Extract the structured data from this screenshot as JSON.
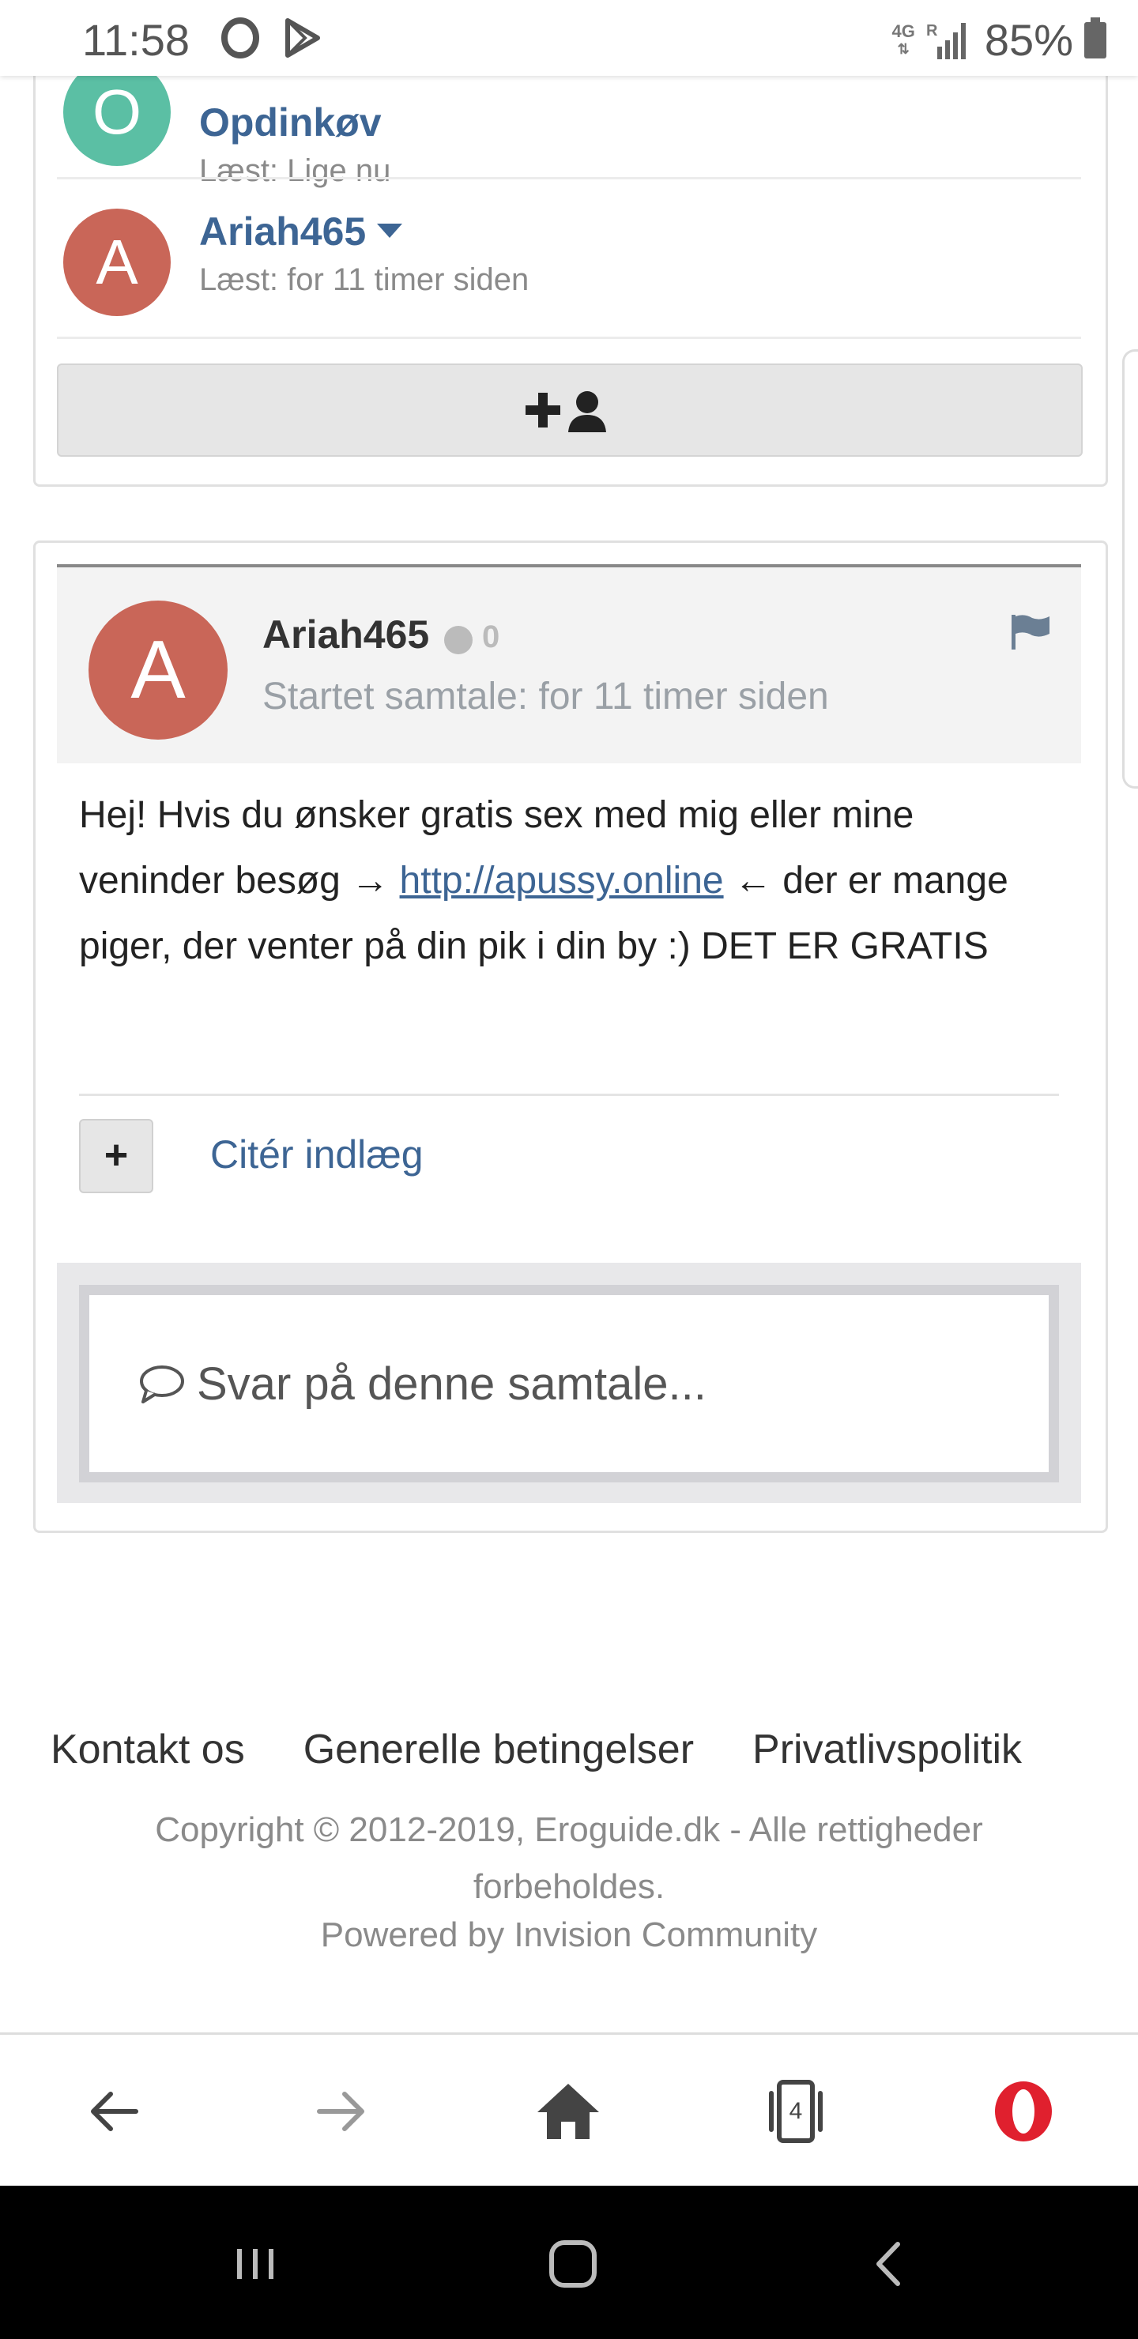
{
  "status_bar": {
    "time": "11:58",
    "network": "4G",
    "roaming": "R",
    "battery": "85%"
  },
  "viewers": [
    {
      "initial": "O",
      "name": "Opdinkøv",
      "last_read": "Læst: Lige nu",
      "avatar_color": "#5bbfa4"
    },
    {
      "initial": "A",
      "name": "Ariah465",
      "last_read": "Læst: for 11 timer siden",
      "avatar_color": "#c96658"
    }
  ],
  "post": {
    "avatar_initial": "A",
    "author": "Ariah465",
    "reputation": "0",
    "started": "Startet samtale: for 11 timer siden",
    "body_before_link": "Hej! Hvis du ønsker gratis sex med mig eller mine veninder besøg → ",
    "link_text": "http://apussy.online",
    "body_after_link": " ← der er mange piger, der venter på din pik i din by :) DET ER GRATIS",
    "multiquote_label": "+",
    "quote_label": "Citér indlæg"
  },
  "reply": {
    "placeholder": "Svar på denne samtale..."
  },
  "footer": {
    "links": [
      "Kontakt os",
      "Generelle betingelser",
      "Privatlivspolitik"
    ],
    "copyright": "Copyright © 2012-2019, Eroguide.dk - Alle rettigheder forbeholdes.",
    "powered": "Powered by Invision Community"
  },
  "browser": {
    "tab_count": "4"
  },
  "colors": {
    "link": "#3d6594",
    "opera_red": "#e0202e"
  }
}
